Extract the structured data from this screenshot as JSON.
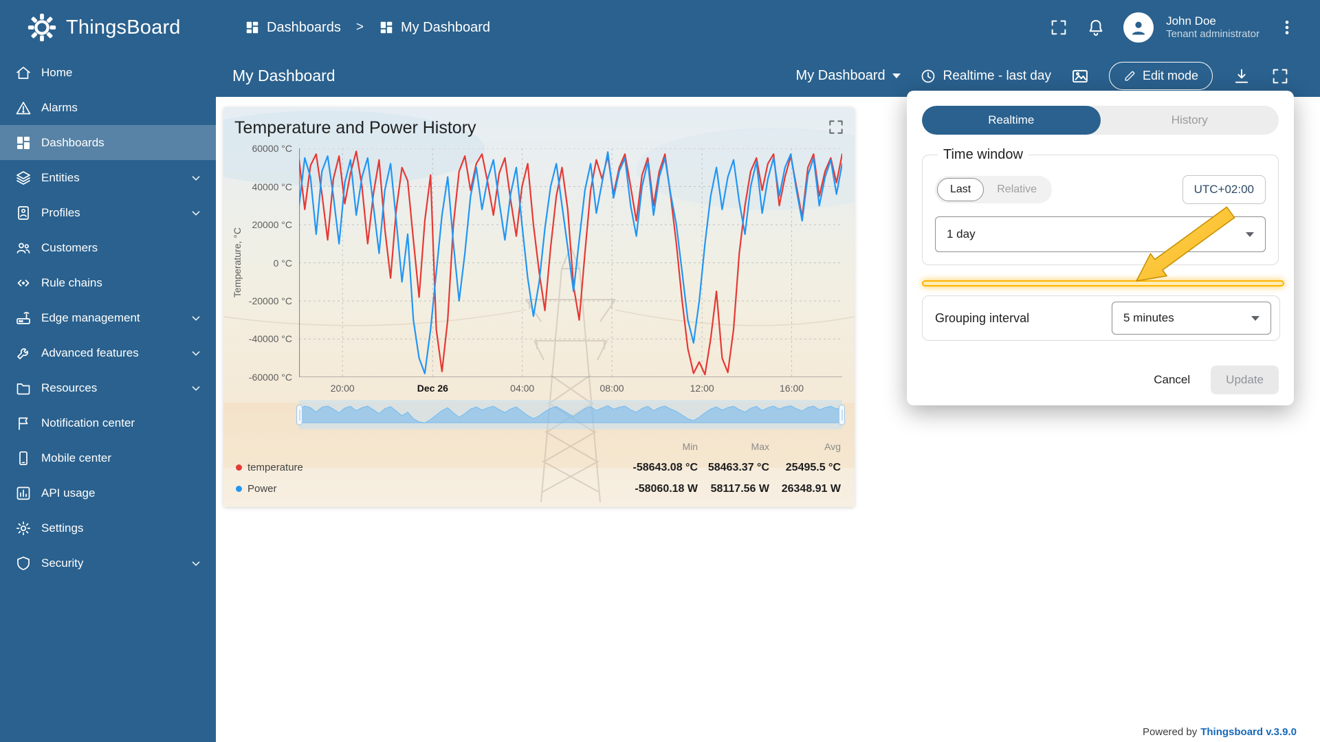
{
  "app": {
    "brand": "ThingsBoard",
    "powered_by": "Powered by",
    "version": "Thingsboard v.3.9.0"
  },
  "header": {
    "breadcrumb": {
      "root": "Dashboards",
      "separator": ">",
      "current": "My Dashboard"
    },
    "user": {
      "name": "John Doe",
      "role": "Tenant administrator"
    }
  },
  "sidebar": {
    "items": [
      {
        "label": "Home"
      },
      {
        "label": "Alarms"
      },
      {
        "label": "Dashboards"
      },
      {
        "label": "Entities"
      },
      {
        "label": "Profiles"
      },
      {
        "label": "Customers"
      },
      {
        "label": "Rule chains"
      },
      {
        "label": "Edge management"
      },
      {
        "label": "Advanced features"
      },
      {
        "label": "Resources"
      },
      {
        "label": "Notification center"
      },
      {
        "label": "Mobile center"
      },
      {
        "label": "API usage"
      },
      {
        "label": "Settings"
      },
      {
        "label": "Security"
      }
    ]
  },
  "toolbar": {
    "title": "My Dashboard",
    "state_selector": "My Dashboard",
    "timewindow": "Realtime - last day",
    "edit_button": "Edit mode"
  },
  "widget": {
    "title": "Temperature and Power History",
    "y_axis_label": "Temperature, °C",
    "y_ticks": [
      "60000 °C",
      "40000 °C",
      "20000 °C",
      "0 °C",
      "-20000 °C",
      "-40000 °C",
      "-60000 °C"
    ],
    "x_ticks": [
      "20:00",
      "Dec 26",
      "04:00",
      "08:00",
      "12:00",
      "16:00"
    ],
    "legend": {
      "headers": {
        "min": "Min",
        "max": "Max",
        "avg": "Avg"
      },
      "rows": [
        {
          "name": "temperature",
          "min": "-58643.08 °C",
          "max": "58463.37 °C",
          "avg": "25495.5 °C"
        },
        {
          "name": "Power",
          "min": "-58060.18 W",
          "max": "58117.56 W",
          "avg": "26348.91 W"
        }
      ]
    }
  },
  "popup": {
    "tabs": {
      "realtime": "Realtime",
      "history": "History"
    },
    "time_window": {
      "title": "Time window",
      "last": "Last",
      "relative": "Relative",
      "timezone": "UTC+02:00",
      "interval": "1 day"
    },
    "grouping": {
      "label": "Grouping interval",
      "value": "5 minutes"
    },
    "cancel": "Cancel",
    "update": "Update"
  },
  "chart_data": {
    "type": "line",
    "title": "Temperature and Power History",
    "y_axis_label": "Temperature, °C",
    "ylim": [
      -60000,
      60000
    ],
    "x_tick_labels": [
      "20:00",
      "Dec 26",
      "04:00",
      "08:00",
      "12:00",
      "16:00"
    ],
    "x_fracs": [
      0.08,
      0.246,
      0.411,
      0.576,
      0.742,
      0.907
    ],
    "series": [
      {
        "name": "temperature",
        "unit": "°C",
        "color": "#e53935",
        "values": [
          54000,
          28000,
          51000,
          57000,
          36000,
          12000,
          44000,
          56000,
          31000,
          47000,
          58463,
          40000,
          10000,
          36000,
          54000,
          18000,
          -8000,
          28000,
          50000,
          43000,
          12000,
          -18000,
          22000,
          46000,
          -35000,
          -57000,
          -30000,
          20000,
          48000,
          56000,
          38000,
          52000,
          57000,
          42000,
          25000,
          47000,
          55000,
          33000,
          14000,
          40000,
          52000,
          20000,
          -5000,
          -25000,
          8000,
          35000,
          50000,
          28000,
          -12000,
          -30000,
          5000,
          38000,
          54000,
          44000,
          56000,
          36000,
          50000,
          57000,
          40000,
          22000,
          46000,
          55000,
          30000,
          48000,
          57000,
          35000,
          10000,
          -20000,
          -45000,
          -58000,
          -52000,
          -58643,
          -40000,
          -15000,
          -50000,
          -57500,
          -35000,
          5000,
          30000,
          48000,
          55000,
          38000,
          52000,
          57000,
          30000,
          45000,
          56000,
          40000,
          24000,
          50000,
          57000,
          35000,
          48000,
          55000,
          42000,
          57000
        ]
      },
      {
        "name": "Power",
        "unit": "W",
        "color": "#2196f3",
        "values": [
          30000,
          55000,
          45000,
          15000,
          48000,
          56000,
          35000,
          10000,
          42000,
          54000,
          25000,
          45000,
          55000,
          30000,
          5000,
          38000,
          52000,
          22000,
          -10000,
          15000,
          -30000,
          -50000,
          -58060,
          -35000,
          -5000,
          25000,
          45000,
          10000,
          -20000,
          5000,
          35000,
          50000,
          28000,
          44000,
          54000,
          32000,
          12000,
          36000,
          50000,
          20000,
          -8000,
          -28000,
          -10000,
          18000,
          40000,
          52000,
          30000,
          8000,
          -15000,
          12000,
          38000,
          52000,
          26000,
          42000,
          58117,
          34000,
          48000,
          55000,
          30000,
          14000,
          40000,
          53000,
          25000,
          45000,
          55000,
          36000,
          20000,
          -5000,
          -30000,
          -42000,
          -20000,
          10000,
          35000,
          50000,
          28000,
          45000,
          54000,
          32000,
          15000,
          40000,
          53000,
          26000,
          44000,
          55000,
          35000,
          50000,
          57000,
          38000,
          22000,
          46000,
          55000,
          30000,
          45000,
          54000,
          36000,
          52000
        ]
      }
    ]
  }
}
